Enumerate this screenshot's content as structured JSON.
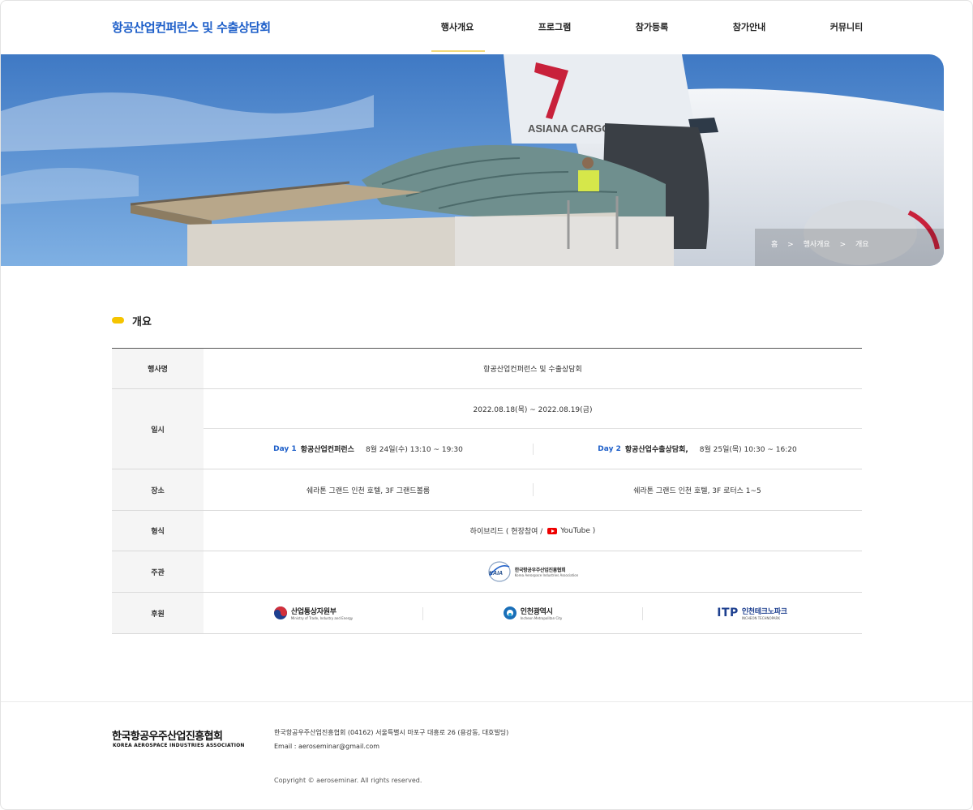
{
  "header": {
    "logo": "항공산업컨퍼런스 및 수출상담회",
    "nav": [
      {
        "label": "행사개요",
        "active": true
      },
      {
        "label": "프로그램"
      },
      {
        "label": "참가등록"
      },
      {
        "label": "참가안내"
      },
      {
        "label": "커뮤니티"
      }
    ]
  },
  "banner": {
    "tail_text": "ASIANA CARGO",
    "breadcrumb": [
      "홈",
      ">",
      "행사개요",
      ">",
      "개요"
    ]
  },
  "section": {
    "title": "개요"
  },
  "table": {
    "event_name": {
      "label": "행사명",
      "value": "항공산업컨퍼런스 및 수출상담회"
    },
    "date": {
      "label": "일시",
      "range": "2022.08.18(목)  ~  2022.08.19(금)",
      "day1": {
        "tag": "Day 1",
        "title": "항공산업컨퍼런스",
        "time": "8월 24일(수) 13:10 ~ 19:30"
      },
      "day2": {
        "tag": "Day 2",
        "title": "항공산업수출상담회,",
        "time": "8월 25일(목) 10:30 ~ 16:20"
      }
    },
    "venue": {
      "label": "장소",
      "left": "쉐라톤 그랜드 인천 호텔, 3F 그랜드볼룸",
      "right": "쉐라톤 그랜드 인천 호텔, 3F 로터스 1~5"
    },
    "format": {
      "label": "형식",
      "prefix": "하이브리드 ( 현장참여 /",
      "youtube": "YouTube )"
    },
    "host": {
      "label": "주관",
      "logo_mark": "KAIA",
      "logo_name": "한국항공우주산업진흥협회",
      "logo_sub": "Korea Aerospace Industries Association"
    },
    "sponsors": {
      "label": "후원",
      "items": [
        {
          "name": "산업통상자원부",
          "sub": "Ministry of Trade, Industry and Energy"
        },
        {
          "name": "인천광역시",
          "sub": "Incheon Metropolitan City"
        },
        {
          "mark": "ITP",
          "name": "인천테크노파크",
          "sub": "INCHEON TECHNOPARK"
        }
      ]
    }
  },
  "footer": {
    "logo_ko": "한국항공우주산업진흥협회",
    "logo_en": "KOREA AEROSPACE INDUSTRIES ASSOCIATION",
    "address": "한국항공우주산업진흥협회   (04162) 서울특별시 마포구 대흥로 26 (용강동, 대호빌딩)",
    "email": "Email : aeroseminar@gmail.com",
    "copyright": "Copyright © aeroseminar. All rights reserved."
  },
  "colors": {
    "brand": "#1e5fc9",
    "accent": "#f5c400",
    "youtube": "#ee0000"
  }
}
